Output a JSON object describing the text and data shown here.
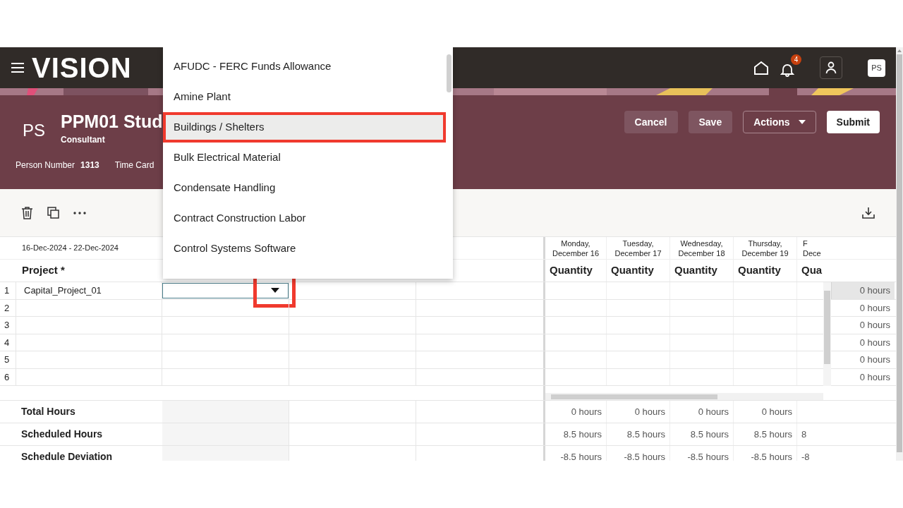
{
  "header": {
    "logo": "VISION",
    "notification_count": "4",
    "user_initials": "PS"
  },
  "person": {
    "initials": "PS",
    "name": "PPM01 Stud",
    "role": "Consultant",
    "fields": [
      {
        "label": "Person Number",
        "value": "1313"
      },
      {
        "label": "Time Card"
      }
    ]
  },
  "actions": [
    {
      "label": "Cancel",
      "kind": "secondary"
    },
    {
      "label": "Save",
      "kind": "secondary"
    },
    {
      "label": "Actions",
      "kind": "menu"
    },
    {
      "label": "Submit",
      "kind": "primary"
    }
  ],
  "grid": {
    "period": "16-Dec-2024 - 22-Dec-2024",
    "project_header": "Project *",
    "days": [
      {
        "day": "Monday,",
        "date": "December 16",
        "header": "Quantity"
      },
      {
        "day": "Tuesday,",
        "date": "December 17",
        "header": "Quantity"
      },
      {
        "day": "Wednesday,",
        "date": "December 18",
        "header": "Quantity"
      },
      {
        "day": "Thursday,",
        "date": "December 19",
        "header": "Quantity"
      },
      {
        "day": "F",
        "date": "Dece",
        "header": "Qua"
      }
    ],
    "combobox": {
      "annotated": true
    },
    "rows": [
      {
        "number": "1",
        "project": "Capital_Project_01",
        "total": "0 hours",
        "selected": true
      },
      {
        "number": "2",
        "total": "0 hours",
        "selected": false
      },
      {
        "number": "3",
        "total": "0 hours",
        "selected": false
      },
      {
        "number": "4",
        "total": "0 hours",
        "selected": false
      },
      {
        "number": "5",
        "total": "0 hours",
        "selected": false
      },
      {
        "number": "6",
        "total": "0 hours",
        "selected": false
      }
    ],
    "totals": [
      {
        "label": "Total Hours",
        "values": [
          "0 hours",
          "0 hours",
          "0 hours",
          "0 hours"
        ]
      },
      {
        "label": "Scheduled Hours",
        "values": [
          "8.5 hours",
          "8.5 hours",
          "8.5 hours",
          "8.5 hours",
          "8"
        ]
      },
      {
        "label": "Schedule Deviation",
        "values": [
          "-8.5 hours",
          "-8.5 hours",
          "-8.5 hours",
          "-8.5 hours",
          "-8"
        ]
      }
    ]
  },
  "dropdown": {
    "items": [
      {
        "label": "AFUDC - FERC Funds Allowance",
        "selected": false,
        "annotated": false
      },
      {
        "label": "Amine Plant",
        "selected": false,
        "annotated": false
      },
      {
        "label": "Buildings / Shelters",
        "selected": true,
        "annotated": true
      },
      {
        "label": "Bulk Electrical Material",
        "selected": false,
        "annotated": false
      },
      {
        "label": "Condensate Handling",
        "selected": false,
        "annotated": false
      },
      {
        "label": "Contract Construction Labor",
        "selected": false,
        "annotated": false
      },
      {
        "label": "Control Systems Software",
        "selected": false,
        "annotated": false
      }
    ]
  }
}
